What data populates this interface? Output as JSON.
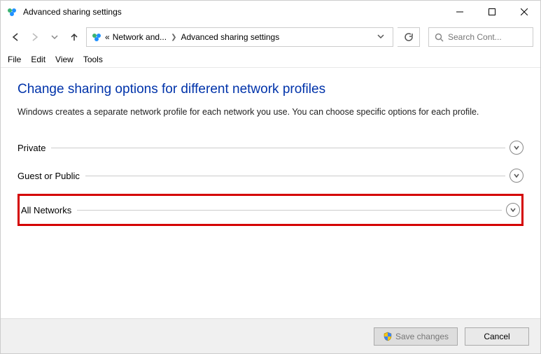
{
  "window": {
    "title": "Advanced sharing settings"
  },
  "breadcrumb": {
    "prefix": "«",
    "part1": "Network and...",
    "part2": "Advanced sharing settings"
  },
  "search": {
    "placeholder": "Search Cont..."
  },
  "menu": {
    "file": "File",
    "edit": "Edit",
    "view": "View",
    "tools": "Tools"
  },
  "heading": "Change sharing options for different network profiles",
  "description": "Windows creates a separate network profile for each network you use. You can choose specific options for each profile.",
  "profiles": {
    "private": "Private",
    "guest": "Guest or Public",
    "all": "All Networks"
  },
  "buttons": {
    "save": "Save changes",
    "cancel": "Cancel"
  }
}
